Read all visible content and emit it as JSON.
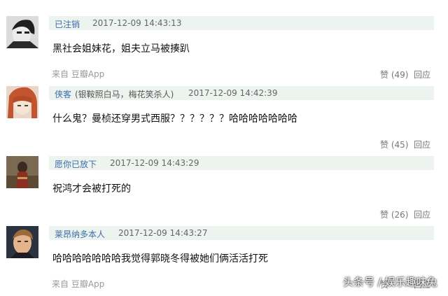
{
  "comments": [
    {
      "username": "已注销",
      "userinfo": "",
      "timestamp": "2017-12-09 14:43:13",
      "text": "黑社会姐妹花，姐夫立马被揍趴",
      "source": "来自 豆瓣App",
      "like": "赞 (49)",
      "reply": "回应"
    },
    {
      "username": "侠客",
      "userinfo": "(银鞍照白马，梅花笑杀人)",
      "timestamp": "2017-12-09 14:42:39",
      "text": "什么鬼？曼桢还穿男式西服？？？？？？哈哈哈哈哈哈哈",
      "source": "",
      "like": "赞 (45)",
      "reply": "回应"
    },
    {
      "username": "愿你已放下",
      "userinfo": "",
      "timestamp": "2017-12-09 14:43:29",
      "text": "祝鸿才会被打死的",
      "source": "",
      "like": "赞 (26)",
      "reply": "回应"
    },
    {
      "username": "莱昂纳多本人",
      "userinfo": "",
      "timestamp": "2017-12-09 14:43:27",
      "text": "哈哈哈哈哈哈哈我觉得郭晓冬得被她们俩活活打死",
      "source": "来自 豆瓣App",
      "like": "赞",
      "reply": "回应"
    }
  ],
  "watermark": "头条号 / 娱乐趣味兔"
}
